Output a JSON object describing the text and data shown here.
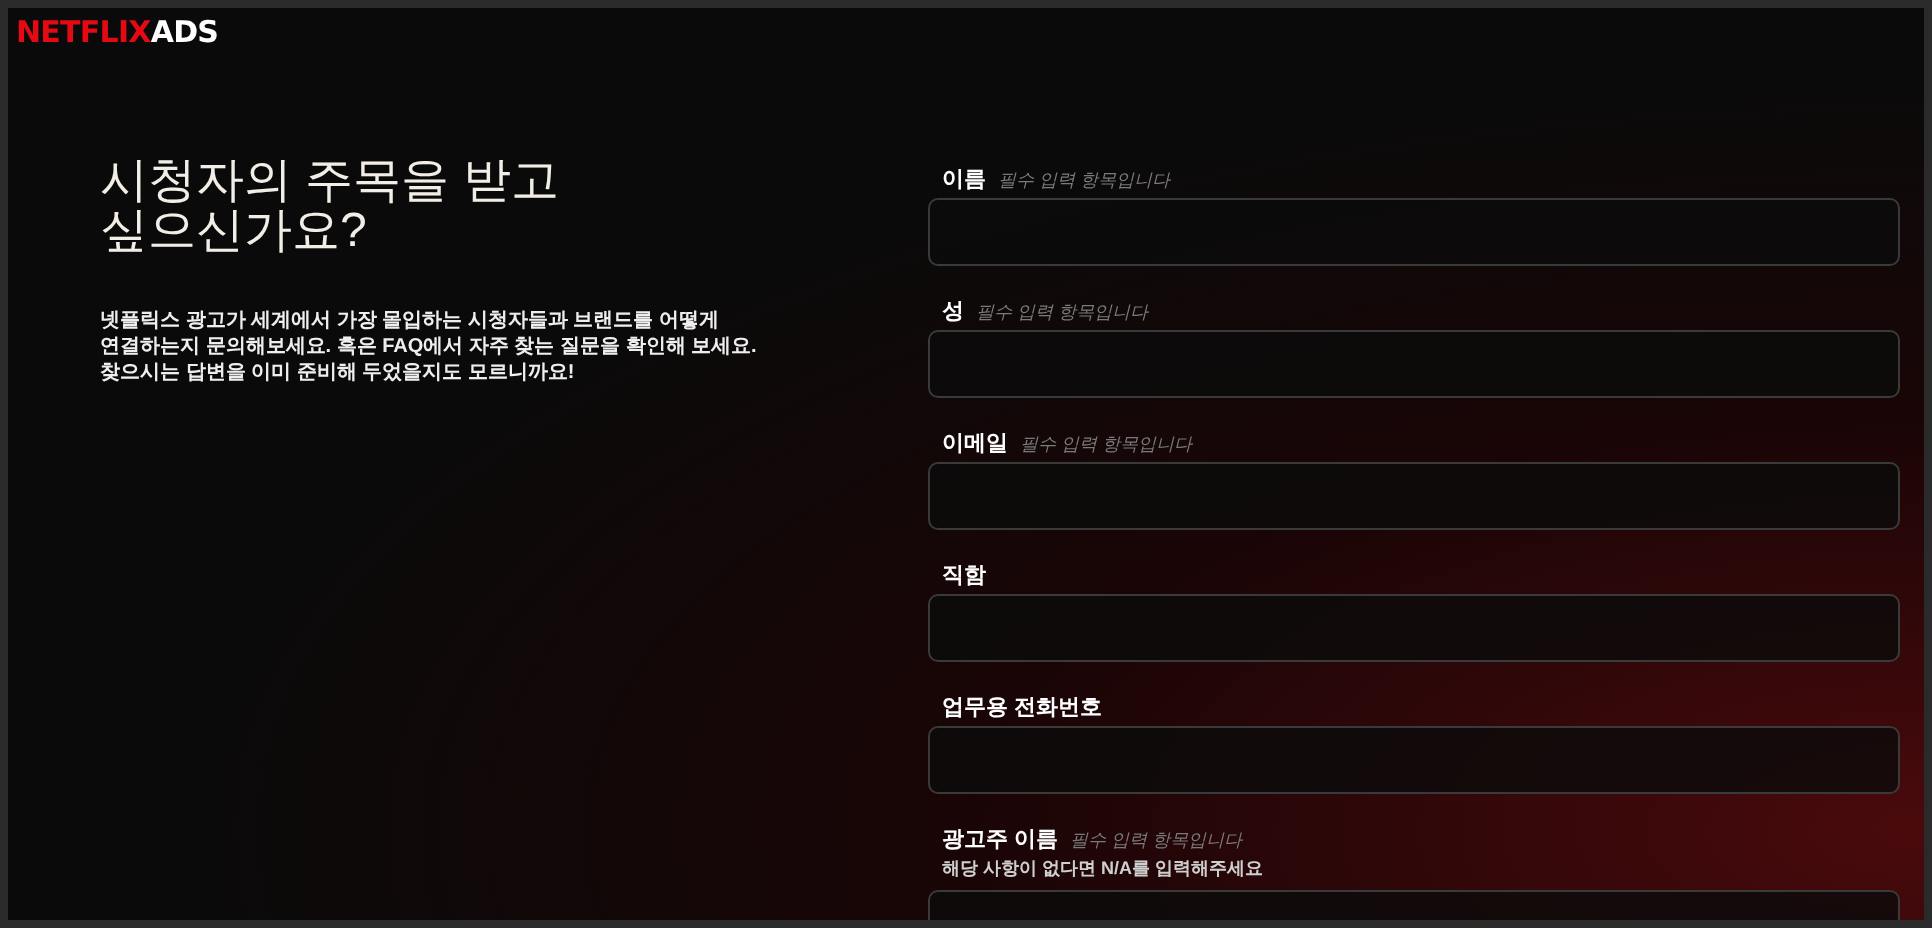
{
  "logo": {
    "brand": "NETFLIX",
    "suffix": "ADS"
  },
  "hero": {
    "title": "시청자의 주목을 받고 싶으신가요?",
    "body": "넷플릭스 광고가 세계에서 가장 몰입하는 시청자들과 브랜드를 어떻게 연결하는지 문의해보세요. 혹은 FAQ에서 자주 찾는 질문을 확인해 보세요. 찾으시는 답변을 이미 준비해 두었을지도 모르니까요!"
  },
  "form": {
    "fields": [
      {
        "label": "이름",
        "hint": "필수 입력 항목입니다"
      },
      {
        "label": "성",
        "hint": "필수 입력 항목입니다"
      },
      {
        "label": "이메일",
        "hint": "필수 입력 항목입니다"
      },
      {
        "label": "직함"
      },
      {
        "label": "업무용 전화번호"
      },
      {
        "label": "광고주 이름",
        "hint": "필수 입력 항목입니다",
        "help": "해당 사항이 없다면 N/A를 입력해주세요"
      }
    ]
  }
}
